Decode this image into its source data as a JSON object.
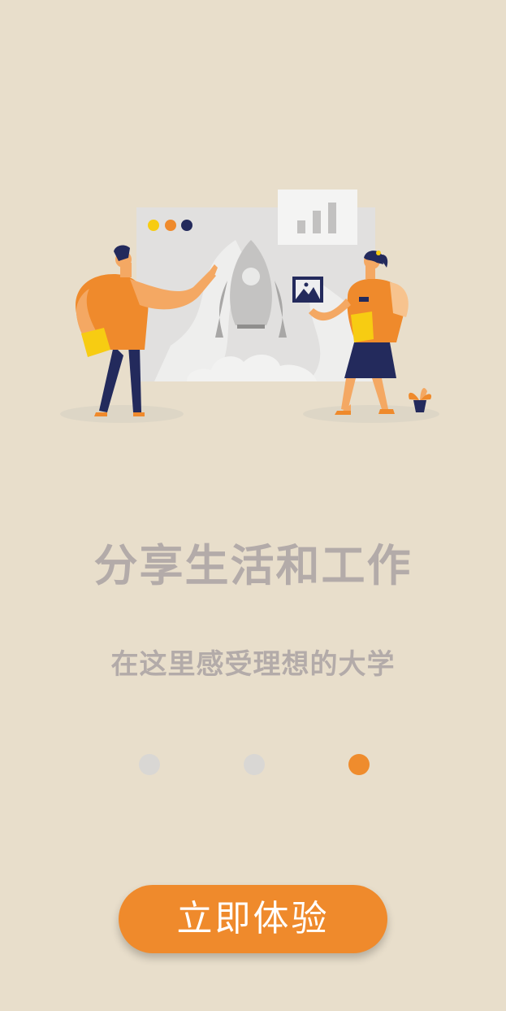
{
  "onboarding": {
    "title": "分享生活和工作",
    "subtitle": "在这里感受理想的大学",
    "page_indicator": {
      "total": 3,
      "current": 3
    },
    "cta_label": "立即体验"
  },
  "colors": {
    "background": "#e8decb",
    "accent": "#ef8a2c",
    "text_muted": "#b3aba9",
    "dot_inactive": "#d9d7d4",
    "navy": "#232a5c",
    "yellow": "#f7cc12"
  },
  "illustration": {
    "icons": [
      "rocket-icon",
      "bar-chart-icon",
      "image-icon",
      "plant-icon",
      "browser-dots-icon"
    ]
  }
}
